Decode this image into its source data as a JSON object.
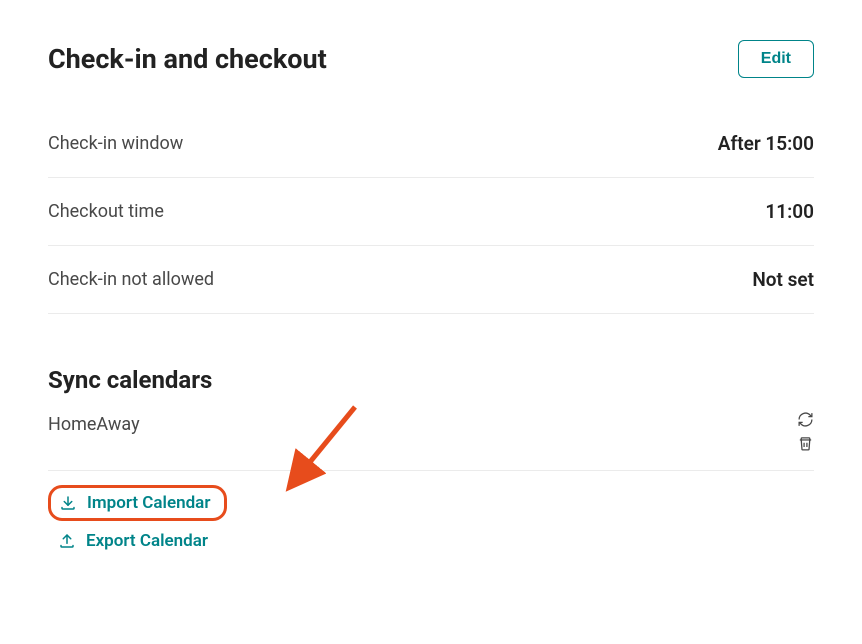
{
  "checkin_section": {
    "title": "Check-in and checkout",
    "edit_label": "Edit",
    "rows": [
      {
        "label": "Check-in window",
        "value": "After 15:00"
      },
      {
        "label": "Checkout time",
        "value": "11:00"
      },
      {
        "label": "Check-in not allowed",
        "value": "Not set"
      }
    ]
  },
  "sync_section": {
    "title": "Sync calendars",
    "calendar_name": "HomeAway",
    "import_label": "Import Calendar",
    "export_label": "Export Calendar"
  },
  "colors": {
    "teal": "#008489",
    "highlight": "#e74c1c"
  }
}
